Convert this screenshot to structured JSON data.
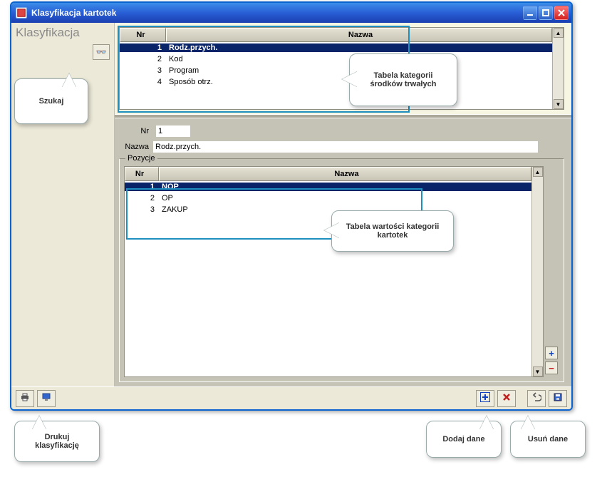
{
  "window": {
    "title": "Klasyfikacja kartotek"
  },
  "sidebar": {
    "title": "Klasyfikacja"
  },
  "upper_grid": {
    "headers": {
      "nr": "Nr",
      "nazwa": "Nazwa"
    },
    "rows": [
      {
        "nr": "1",
        "nazwa": "Rodz.przych."
      },
      {
        "nr": "2",
        "nazwa": "Kod"
      },
      {
        "nr": "3",
        "nazwa": "Program"
      },
      {
        "nr": "4",
        "nazwa": "Sposób otrz."
      }
    ],
    "selected_index": 0
  },
  "detail": {
    "nr_label": "Nr",
    "nr_value": "1",
    "nazwa_label": "Nazwa",
    "nazwa_value": "Rodz.przych."
  },
  "pozycje": {
    "group_label": "Pozycje",
    "headers": {
      "nr": "Nr",
      "nazwa": "Nazwa"
    },
    "rows": [
      {
        "nr": "1",
        "nazwa": "NOP"
      },
      {
        "nr": "2",
        "nazwa": "OP"
      },
      {
        "nr": "3",
        "nazwa": "ZAKUP"
      }
    ],
    "selected_index": 0
  },
  "callouts": {
    "szukaj": "Szukaj",
    "tabkat": "Tabela kategorii środków trwałych",
    "tabwart": "Tabela wartości kategorii kartotek",
    "drukuj": "Drukuj klasyfikację",
    "dodaj": "Dodaj dane",
    "usun": "Usuń dane"
  },
  "icons": {
    "scroll_up": "▲",
    "scroll_down": "▼",
    "binoculars": "👓",
    "plus": "+",
    "minus": "−"
  }
}
